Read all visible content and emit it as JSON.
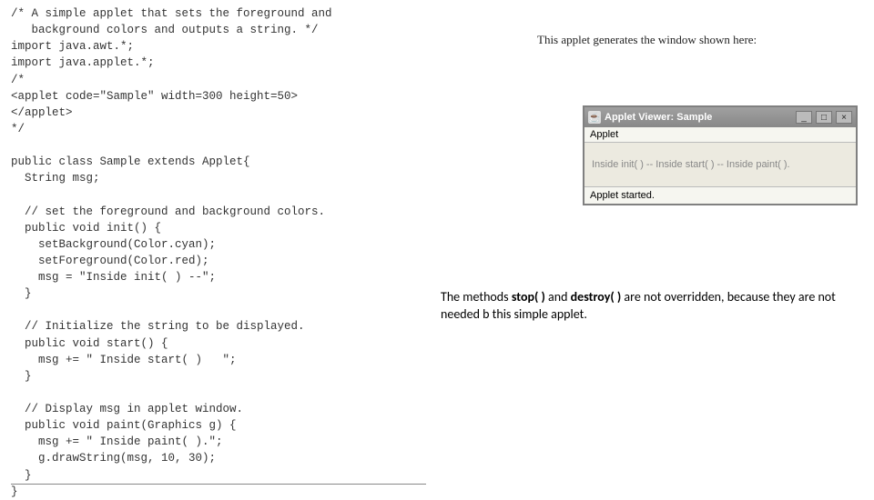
{
  "code": "/* A simple applet that sets the foreground and\n   background colors and outputs a string. */\nimport java.awt.*;\nimport java.applet.*;\n/*\n<applet code=\"Sample\" width=300 height=50>\n</applet>\n*/\n\npublic class Sample extends Applet{\n  String msg;\n\n  // set the foreground and background colors.\n  public void init() {\n    setBackground(Color.cyan);\n    setForeground(Color.red);\n    msg = \"Inside init( ) --\";\n  }\n\n  // Initialize the string to be displayed.\n  public void start() {\n    msg += \" Inside start( )   \";\n  }\n\n  // Display msg in applet window.\n  public void paint(Graphics g) {\n    msg += \" Inside paint( ).\";\n    g.drawString(msg, 10, 30);\n  }\n}",
  "caption": "This applet generates the window shown here:",
  "applet": {
    "icon_glyph": "☕",
    "title": "Applet Viewer: Sample",
    "min_glyph": "_",
    "max_glyph": "□",
    "close_glyph": "×",
    "menu": "Applet",
    "body": "Inside init( ) -- Inside start( ) -- Inside paint( ).",
    "status": "Applet started."
  },
  "note_part1": "The methods ",
  "note_stop": "stop( )",
  "note_and": " and ",
  "note_destroy": "destroy( )",
  "note_part2": " are not overridden, because they are not needed b this simple applet."
}
